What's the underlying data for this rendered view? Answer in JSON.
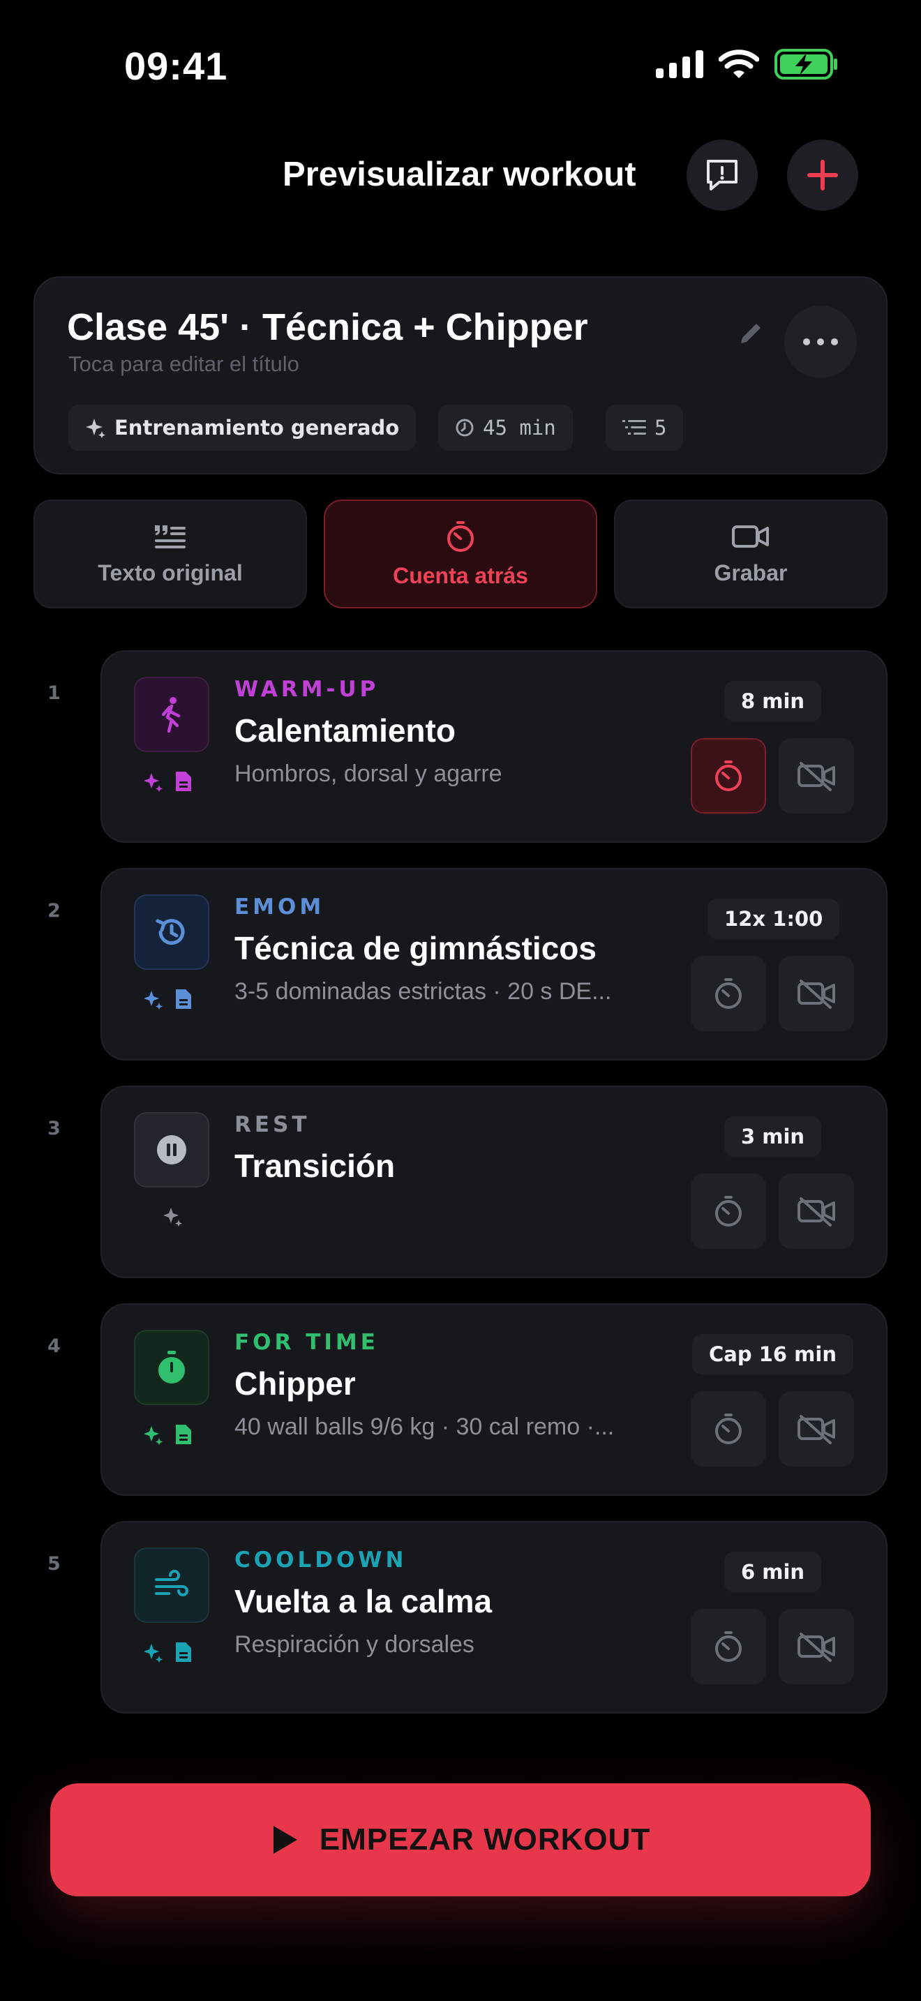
{
  "status_bar": {
    "time": "09:41"
  },
  "header": {
    "title": "Previsualizar workout"
  },
  "workout": {
    "title": "Clase 45' · Técnica + Chipper",
    "subtitle": "Toca para editar el título",
    "chips": {
      "generated": "Entrenamiento generado",
      "duration": "45 min",
      "blocks": "5"
    }
  },
  "modes": [
    {
      "label": "Texto original"
    },
    {
      "label": "Cuenta atrás"
    },
    {
      "label": "Grabar"
    }
  ],
  "blocks": [
    {
      "index": "1",
      "type": "WARM-UP",
      "name": "Calentamiento",
      "desc": "Hombros, dorsal y agarre",
      "duration": "8 min",
      "color": "#c23fd8"
    },
    {
      "index": "2",
      "type": "EMOM",
      "name": "Técnica de gimnásticos",
      "desc": "3-5 dominadas estrictas · 20 s DE...",
      "duration": "12x 1:00",
      "color": "#5b8fd8"
    },
    {
      "index": "3",
      "type": "REST",
      "name": "Transición",
      "desc": "",
      "duration": "3 min",
      "color": "#8b8f98"
    },
    {
      "index": "4",
      "type": "FOR TIME",
      "name": "Chipper",
      "desc": "40 wall balls 9/6 kg · 30 cal remo ·...",
      "duration": "Cap 16 min",
      "color": "#2fbf6e"
    },
    {
      "index": "5",
      "type": "COOLDOWN",
      "name": "Vuelta a la calma",
      "desc": "Respiración y dorsales",
      "duration": "6 min",
      "color": "#1aa3b5"
    }
  ],
  "start_button": {
    "label": "EMPEZAR WORKOUT"
  }
}
